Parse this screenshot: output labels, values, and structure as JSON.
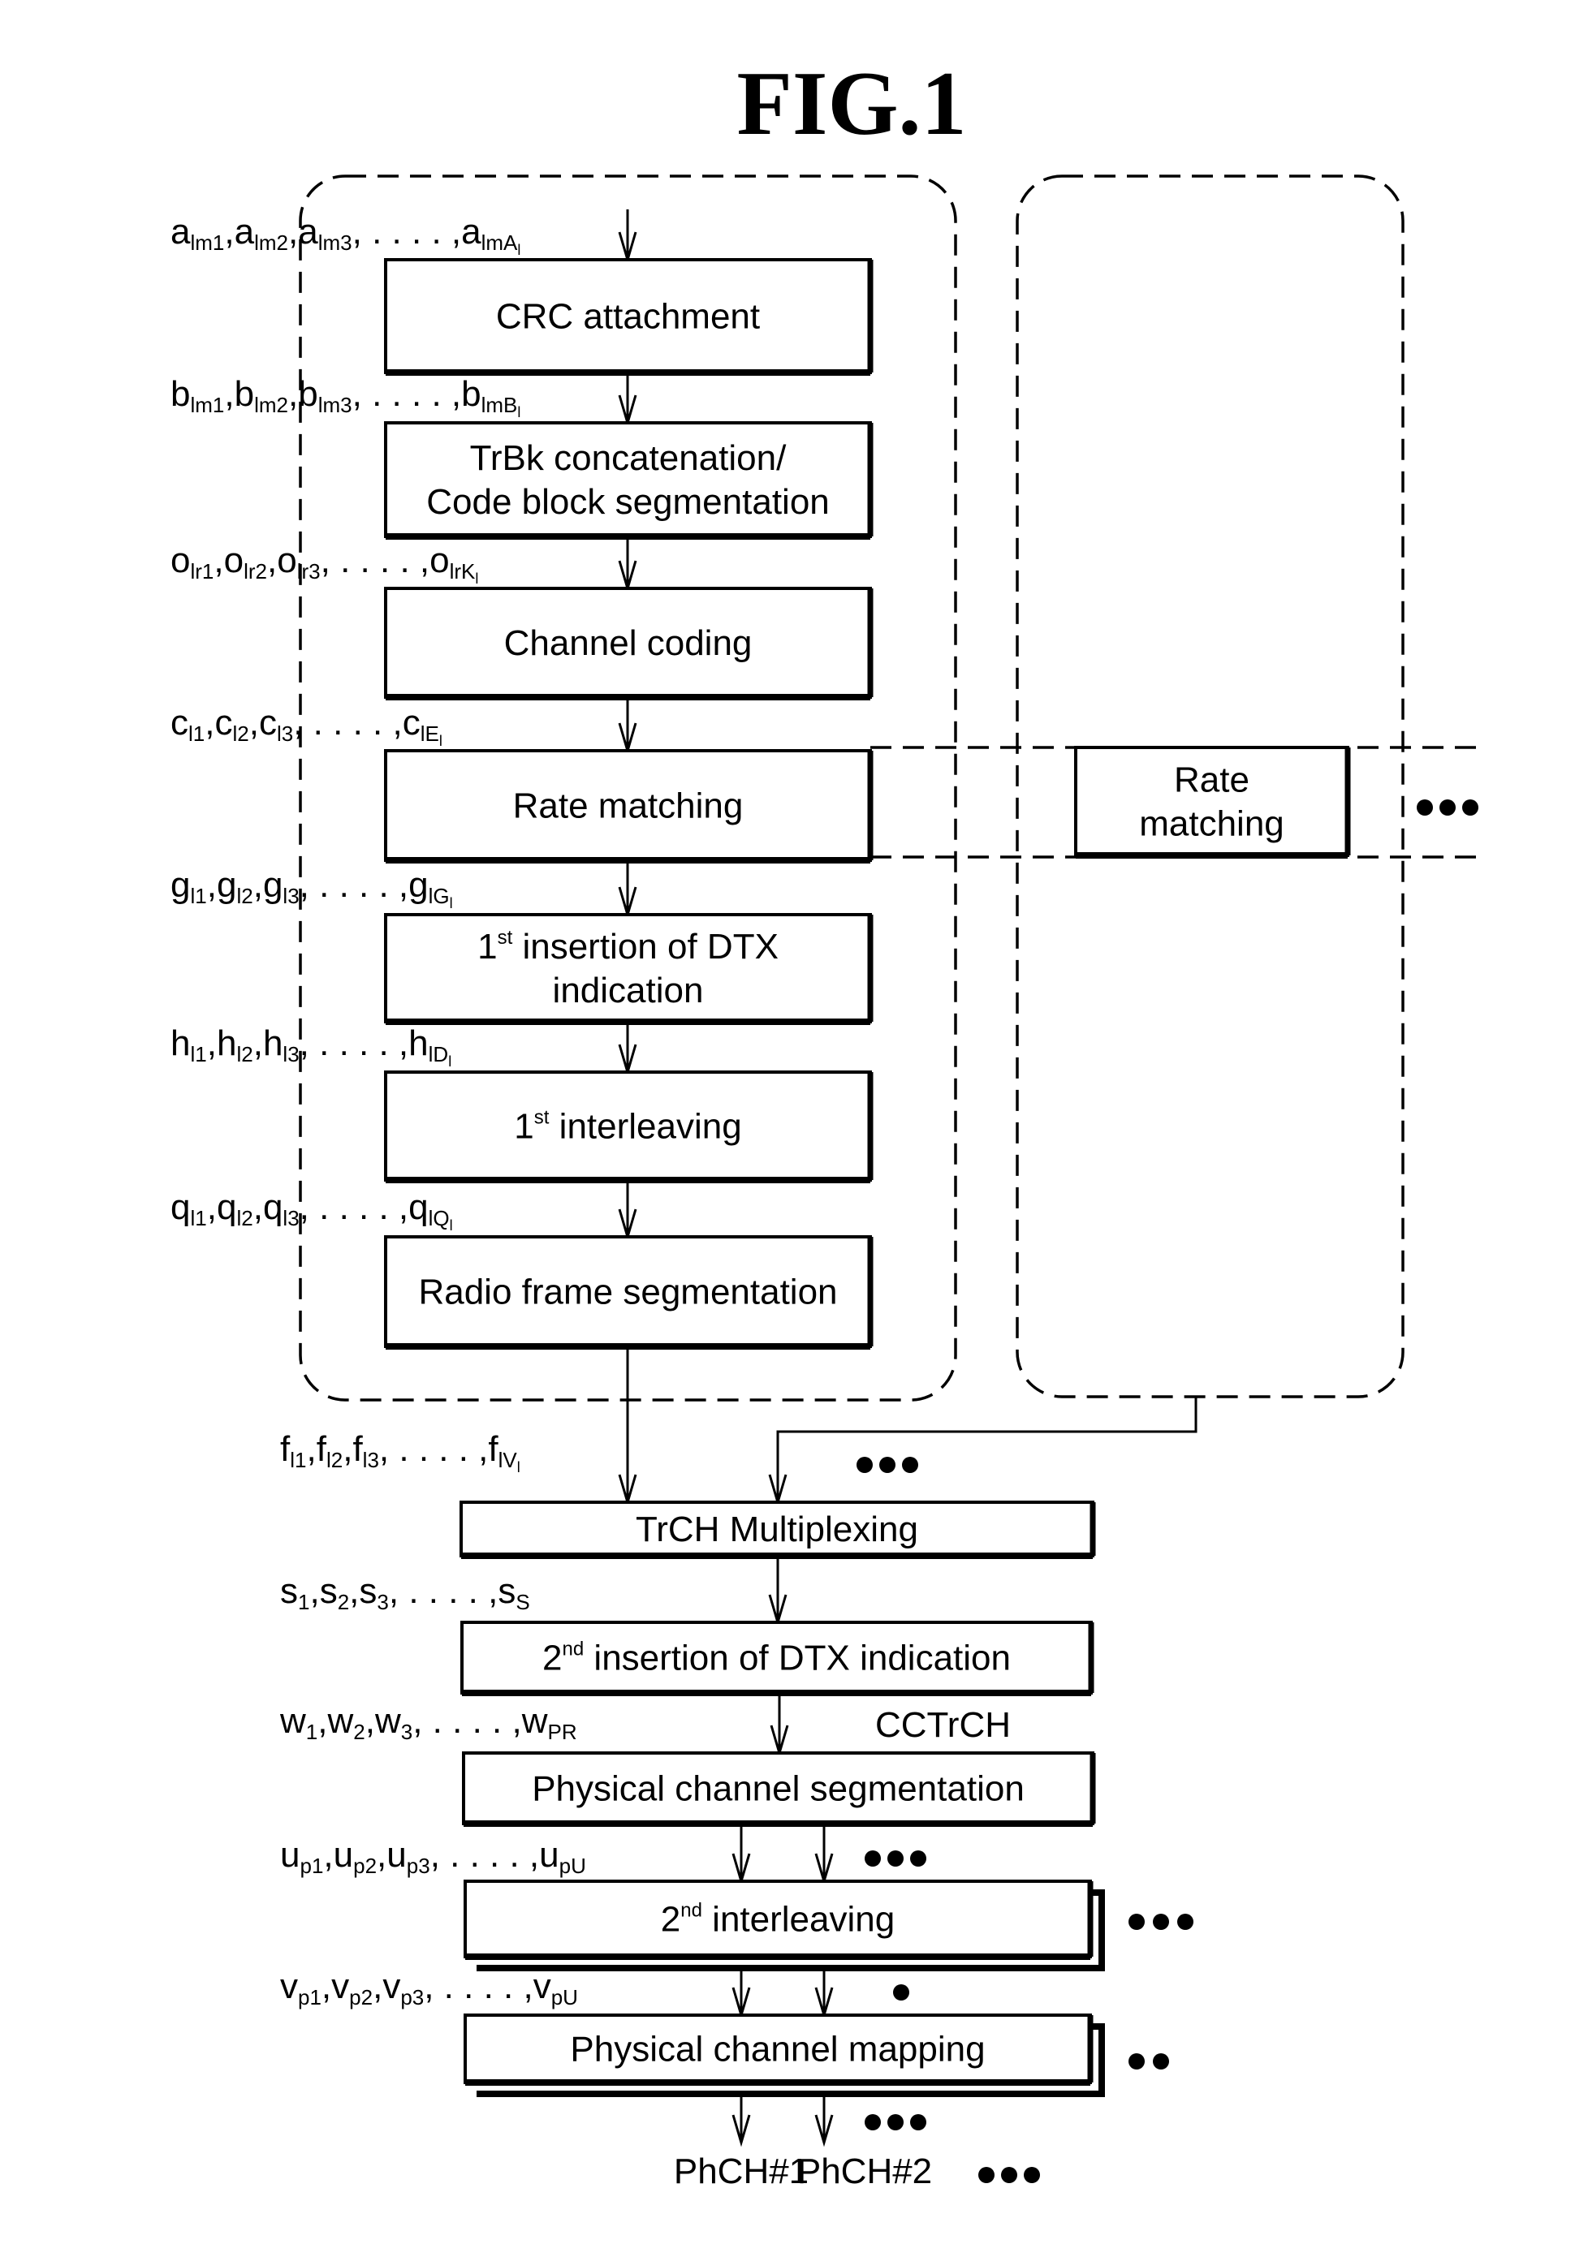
{
  "figure": {
    "title": "FIG.1"
  },
  "transport_channel_blocks": [
    {
      "id": "crc",
      "lines": [
        "CRC attachment"
      ]
    },
    {
      "id": "trbk",
      "lines": [
        "TrBk concatenation/",
        "Code block segmentation"
      ]
    },
    {
      "id": "channel-coding",
      "lines": [
        "Channel coding"
      ]
    },
    {
      "id": "rate-matching",
      "lines": [
        "Rate matching"
      ]
    },
    {
      "id": "dtx1",
      "lines": [
        "1",
        "st",
        " insertion of DTX",
        "indication"
      ]
    },
    {
      "id": "interleaving1",
      "lines": [
        "1",
        "st",
        " interleaving"
      ]
    },
    {
      "id": "radio-frame",
      "lines": [
        "Radio frame segmentation"
      ]
    }
  ],
  "right_branch": {
    "rate_matching_lines": [
      "Rate",
      "matching"
    ],
    "ellipsis": "•••"
  },
  "sequence_labels": [
    {
      "base": "a",
      "subs": [
        "lm1",
        "lm2",
        "lm3",
        "lmA"
      ],
      "last_sub_index": "l"
    },
    {
      "base": "b",
      "subs": [
        "lm1",
        "lm2",
        "lm3",
        "lmB"
      ],
      "last_sub_index": "l"
    },
    {
      "base": "o",
      "subs": [
        "lr1",
        "lr2",
        "lr3",
        "lrK"
      ],
      "last_sub_index": "l"
    },
    {
      "base": "c",
      "subs": [
        "l1",
        "l2",
        "l3",
        "lE"
      ],
      "last_sub_index": "l"
    },
    {
      "base": "g",
      "subs": [
        "l1",
        "l2",
        "l3",
        "lG"
      ],
      "last_sub_index": "l"
    },
    {
      "base": "h",
      "subs": [
        "l1",
        "l2",
        "l3",
        "lD"
      ],
      "last_sub_index": "l"
    },
    {
      "base": "q",
      "subs": [
        "l1",
        "l2",
        "l3",
        "lQ"
      ],
      "last_sub_index": "l"
    },
    {
      "base": "f",
      "subs": [
        "l1",
        "l2",
        "l3",
        "lV"
      ],
      "last_sub_index": "l"
    },
    {
      "base": "s",
      "subs": [
        "1",
        "2",
        "3",
        "S"
      ],
      "last_sub_index": ""
    },
    {
      "base": "w",
      "subs": [
        "1",
        "2",
        "3",
        "PR"
      ],
      "last_sub_index": ""
    },
    {
      "base": "u",
      "subs": [
        "p1",
        "p2",
        "p3",
        "pU"
      ],
      "last_sub_index": ""
    },
    {
      "base": "v",
      "subs": [
        "p1",
        "p2",
        "p3",
        "pU"
      ],
      "last_sub_index": ""
    }
  ],
  "cctrch_blocks": [
    {
      "id": "trch-mux",
      "lines": [
        "TrCH Multiplexing"
      ]
    },
    {
      "id": "dtx2",
      "lines": [
        "2",
        "nd",
        " insertion of DTX indication"
      ]
    },
    {
      "id": "phys-seg",
      "lines": [
        "Physical channel segmentation"
      ]
    },
    {
      "id": "interleaving2",
      "lines": [
        "2",
        "nd",
        " interleaving"
      ]
    },
    {
      "id": "phys-map",
      "lines": [
        "Physical channel mapping"
      ]
    }
  ],
  "cctrch_label": "CCTrCH",
  "outputs": [
    "PhCH#1",
    "PhCH#2"
  ],
  "ellipsis": "•••"
}
